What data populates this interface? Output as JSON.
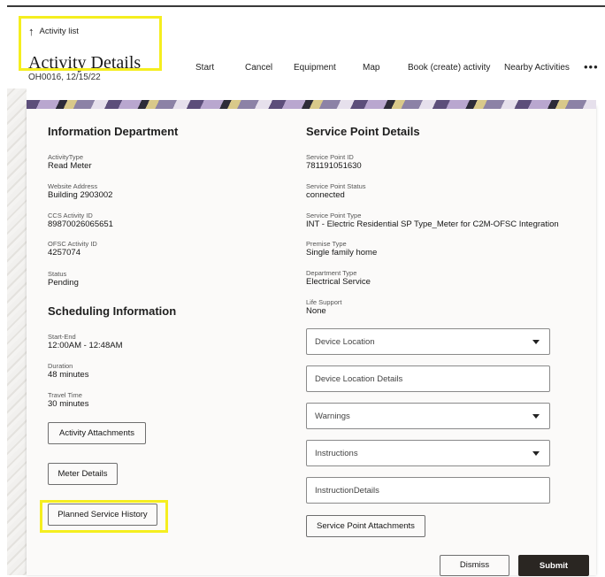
{
  "header": {
    "back_label": "Activity list",
    "title": "Activity Details",
    "subtitle": "OH0016, 12/15/22"
  },
  "toolbar": {
    "start": "Start",
    "cancel": "Cancel",
    "equipment": "Equipment",
    "map": "Map",
    "book": "Book (create) activity",
    "nearby": "Nearby Activities",
    "more": "•••"
  },
  "information": {
    "title": "Information Department",
    "activity_type": {
      "label": "ActivityType",
      "value": "Read Meter"
    },
    "website_address": {
      "label": "Website Address",
      "value": "Building 2903002"
    },
    "ccs_activity_id": {
      "label": "CCS Activity ID",
      "value": "89870026065651"
    },
    "ofsc_activity_id": {
      "label": "OFSC Activity ID",
      "value": "4257074"
    },
    "status": {
      "label": "Status",
      "value": "Pending"
    }
  },
  "scheduling": {
    "title": "Scheduling Information",
    "start_end": {
      "label": "Start-End",
      "value": "12:00AM - 12:48AM"
    },
    "duration": {
      "label": "Duration",
      "value": "48 minutes"
    },
    "travel_time": {
      "label": "Travel Time",
      "value": "30 minutes"
    },
    "activity_attachments_label": "Activity Attachments",
    "meter_details_label": "Meter Details",
    "planned_service_history_label": "Planned Service History"
  },
  "service_point": {
    "title": "Service Point Details",
    "id": {
      "label": "Service Point ID",
      "value": "781191051630"
    },
    "status": {
      "label": "Service Point Status",
      "value": "connected"
    },
    "type": {
      "label": "Service Point Type",
      "value": "INT - Electric Residential SP Type_Meter for C2M-OFSC Integration"
    },
    "premise_type": {
      "label": "Premise Type",
      "value": "Single family home"
    },
    "department_type": {
      "label": "Department Type",
      "value": "Electrical Service"
    },
    "life_support": {
      "label": "Life Support",
      "value": "None"
    },
    "device_location": "Device Location",
    "device_location_details": "Device Location Details",
    "warnings": "Warnings",
    "instructions": "Instructions",
    "instruction_details": "InstructionDetails",
    "attachments_label": "Service Point Attachments"
  },
  "footer": {
    "dismiss_label": "Dismiss",
    "submit_label": "Submit"
  },
  "colors": {
    "highlight": "#f5ee1f",
    "submit_bg": "#2a2622",
    "card_bg": "#fbfaf9"
  }
}
